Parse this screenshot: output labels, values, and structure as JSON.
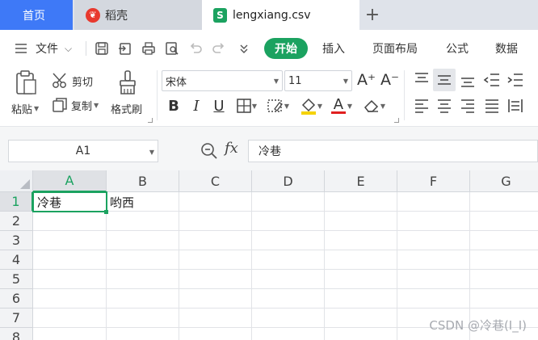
{
  "tabs": {
    "home": "首页",
    "daoke": "稻壳",
    "file": "lengxiang.csv",
    "add": "+",
    "daoke_icon": "daoke-logo-icon",
    "file_icon": "spreadsheet-s-icon",
    "close": "✕"
  },
  "menu": {
    "file_label": "文件",
    "start": "开始",
    "insert": "插入",
    "page_layout": "页面布局",
    "formula": "公式",
    "data": "数据"
  },
  "ribbon": {
    "paste": "粘贴",
    "cut": "剪切",
    "copy": "复制",
    "format_painter": "格式刷",
    "font_name": "宋体",
    "font_size": "11",
    "bold": "B",
    "italic": "I",
    "underline": "U",
    "grow_font": "A⁺",
    "shrink_font": "A⁻",
    "font_color_letter": "A"
  },
  "formula_bar": {
    "name_box": "A1",
    "fx": "fx",
    "content": "冷巷"
  },
  "grid": {
    "columns": [
      "A",
      "B",
      "C",
      "D",
      "E",
      "F",
      "G"
    ],
    "rows": [
      "1",
      "2",
      "3",
      "4",
      "5",
      "6",
      "7",
      "8"
    ],
    "cells": {
      "A1": "冷巷",
      "B1": "哟西"
    }
  },
  "watermark": "CSDN @冷巷(I_I)",
  "colors": {
    "accent_green": "#1ba260",
    "home_tab_blue": "#3e79f7",
    "tab_bar_bg": "#dfe3ea"
  }
}
